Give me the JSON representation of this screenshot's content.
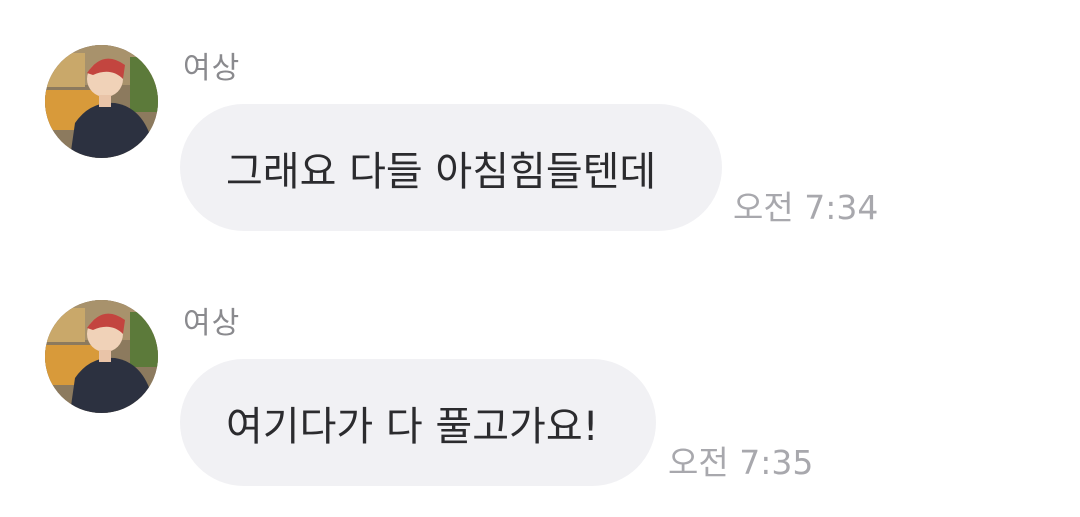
{
  "messages": [
    {
      "sender": "여상",
      "text": "그래요 다들 아침힘들텐데",
      "time": "오전 7:34"
    },
    {
      "sender": "여상",
      "text": "여기다가 다 풀고가요!",
      "time": "오전 7:35"
    }
  ],
  "colors": {
    "bubble": "#f1f1f4",
    "sender_text": "#8a8a8e",
    "time_text": "#a8a8ad",
    "message_text": "#2b2b2e"
  }
}
